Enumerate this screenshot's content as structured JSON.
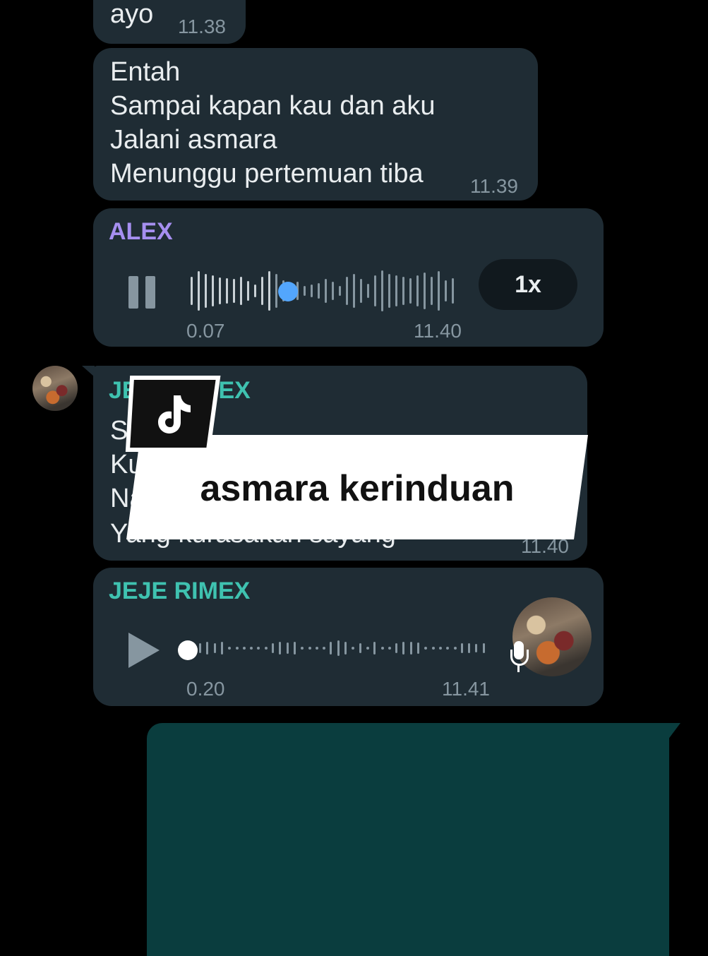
{
  "messages": [
    {
      "text": "ayo",
      "time": "11.38"
    },
    {
      "text": "Entah\nSampai kapan kau dan aku\nJalani asmara\nMenunggu pertemuan tiba",
      "time": "11.39"
    }
  ],
  "voice_alex": {
    "sender": "ALEX",
    "sender_color": "#a68ff0",
    "duration": "0.07",
    "time": "11.40",
    "speed": "1x",
    "state": "playing",
    "progress": 0.3
  },
  "jeje_text": {
    "sender": "JEJE RIMEX",
    "sender_visible": [
      "JE",
      "IEX"
    ],
    "sender_color": "#3fc2b0",
    "line_fragments": [
      "Se",
      "Ku",
      "Na",
      "Yang kurasakan sayang"
    ],
    "time": "11.40"
  },
  "voice_jeje": {
    "sender": "JEJE RIMEX",
    "sender_color": "#3fc2b0",
    "duration": "0.20",
    "time": "11.41",
    "state": "paused",
    "progress": 0.0
  },
  "overlay": {
    "caption": "asmara kerinduan",
    "logo": "tiktok-logo"
  },
  "colors": {
    "background": "#000000",
    "incoming_bubble": "#1f2c34",
    "outgoing_bubble": "#0a3d3e",
    "accent_blue": "#53a6fd"
  }
}
